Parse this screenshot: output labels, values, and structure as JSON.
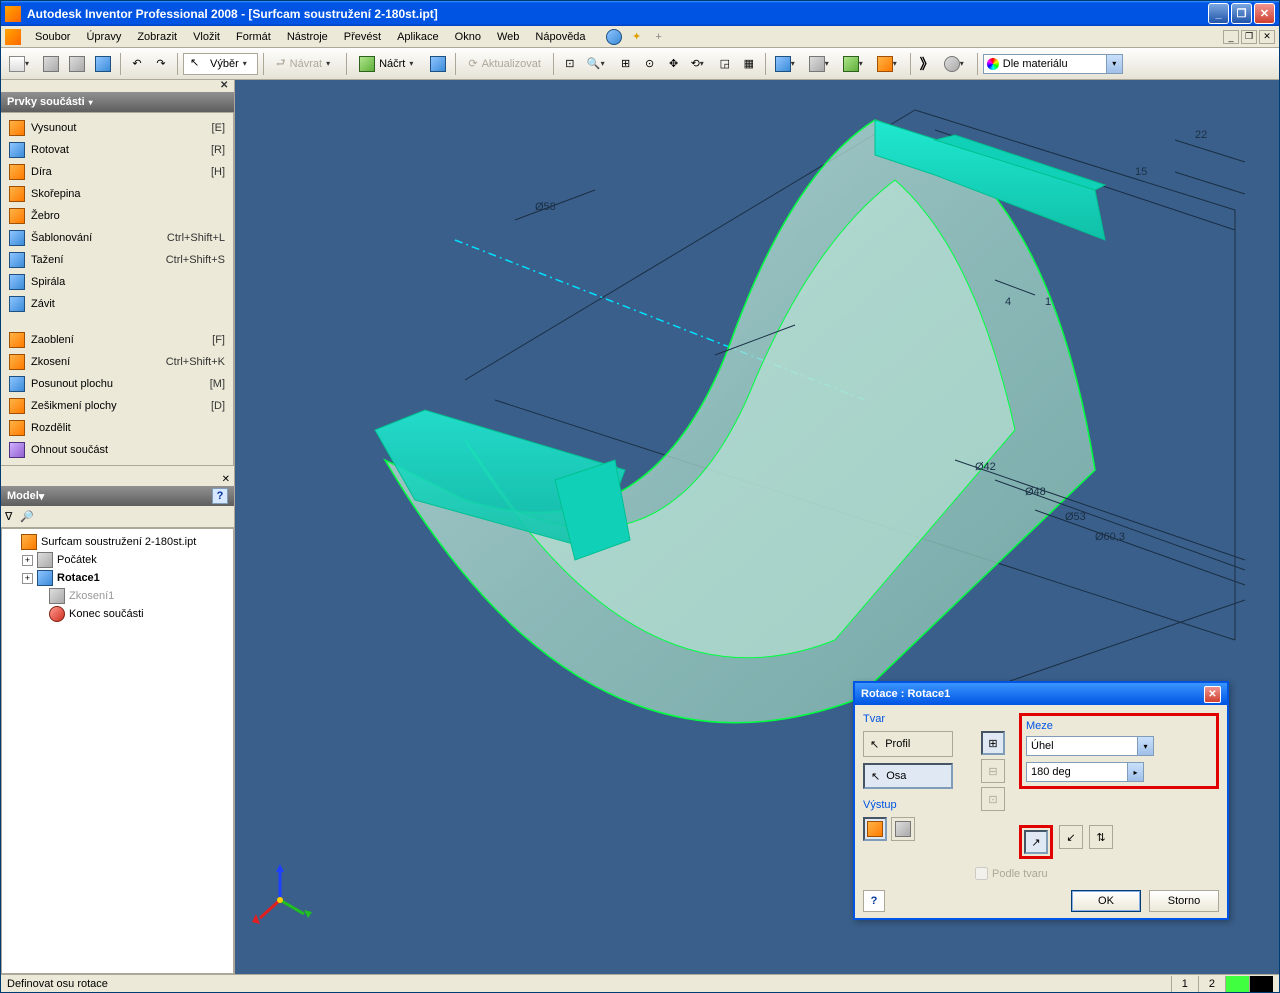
{
  "title": "Autodesk Inventor Professional 2008 - [Surfcam soustružení 2-180st.ipt]",
  "menu": [
    "Soubor",
    "Úpravy",
    "Zobrazit",
    "Vložit",
    "Formát",
    "Nástroje",
    "Převést",
    "Aplikace",
    "Okno",
    "Web",
    "Nápověda"
  ],
  "toolbar": {
    "vyber": "Výběr",
    "navrat": "Návrat",
    "nacrt": "Náčrt",
    "aktualizovat": "Aktualizovat",
    "material": "Dle materiálu"
  },
  "features_panel": {
    "title": "Prvky součásti",
    "items": [
      {
        "label": "Vysunout",
        "shortcut": "[E]",
        "ic": "ic-orange"
      },
      {
        "label": "Rotovat",
        "shortcut": "[R]",
        "ic": "ic-blue"
      },
      {
        "label": "Díra",
        "shortcut": "[H]",
        "ic": "ic-orange"
      },
      {
        "label": "Skořepina",
        "shortcut": "",
        "ic": "ic-orange"
      },
      {
        "label": "Žebro",
        "shortcut": "",
        "ic": "ic-orange"
      },
      {
        "label": "Šablonování",
        "shortcut": "Ctrl+Shift+L",
        "ic": "ic-blue"
      },
      {
        "label": "Tažení",
        "shortcut": "Ctrl+Shift+S",
        "ic": "ic-blue"
      },
      {
        "label": "Spirála",
        "shortcut": "",
        "ic": "ic-blue"
      },
      {
        "label": "Závit",
        "shortcut": "",
        "ic": "ic-blue"
      },
      {
        "spacer": true
      },
      {
        "label": "Zaoblení",
        "shortcut": "[F]",
        "ic": "ic-orange"
      },
      {
        "label": "Zkosení",
        "shortcut": "Ctrl+Shift+K",
        "ic": "ic-orange"
      },
      {
        "label": "Posunout plochu",
        "shortcut": "[M]",
        "ic": "ic-blue"
      },
      {
        "label": "Zešikmení plochy",
        "shortcut": "[D]",
        "ic": "ic-orange"
      },
      {
        "label": "Rozdělit",
        "shortcut": "",
        "ic": "ic-orange"
      },
      {
        "label": "Ohnout součást",
        "shortcut": "",
        "ic": "ic-purple"
      }
    ]
  },
  "model_panel": {
    "title": "Model",
    "tree": {
      "root": "Surfcam soustružení 2-180st.ipt",
      "pocatek": "Počátek",
      "rotace": "Rotace1",
      "zkoseni": "Zkosení1",
      "konec": "Konec součásti"
    }
  },
  "dims": {
    "d58": "Ø58",
    "d42": "Ø42",
    "d48": "Ø48",
    "d53": "Ø53",
    "d603": "Ø60,3",
    "l22": "22",
    "l15": "15",
    "l4": "4",
    "l1": "1"
  },
  "dialog": {
    "title": "Rotace : Rotace1",
    "tvar": "Tvar",
    "profil": "Profil",
    "osa": "Osa",
    "vystup": "Výstup",
    "meze": "Meze",
    "uhel": "Úhel",
    "val": "180 deg",
    "podle": "Podle tvaru",
    "ok": "OK",
    "storno": "Storno"
  },
  "status": {
    "msg": "Definovat osu rotace",
    "n1": "1",
    "n2": "2"
  }
}
